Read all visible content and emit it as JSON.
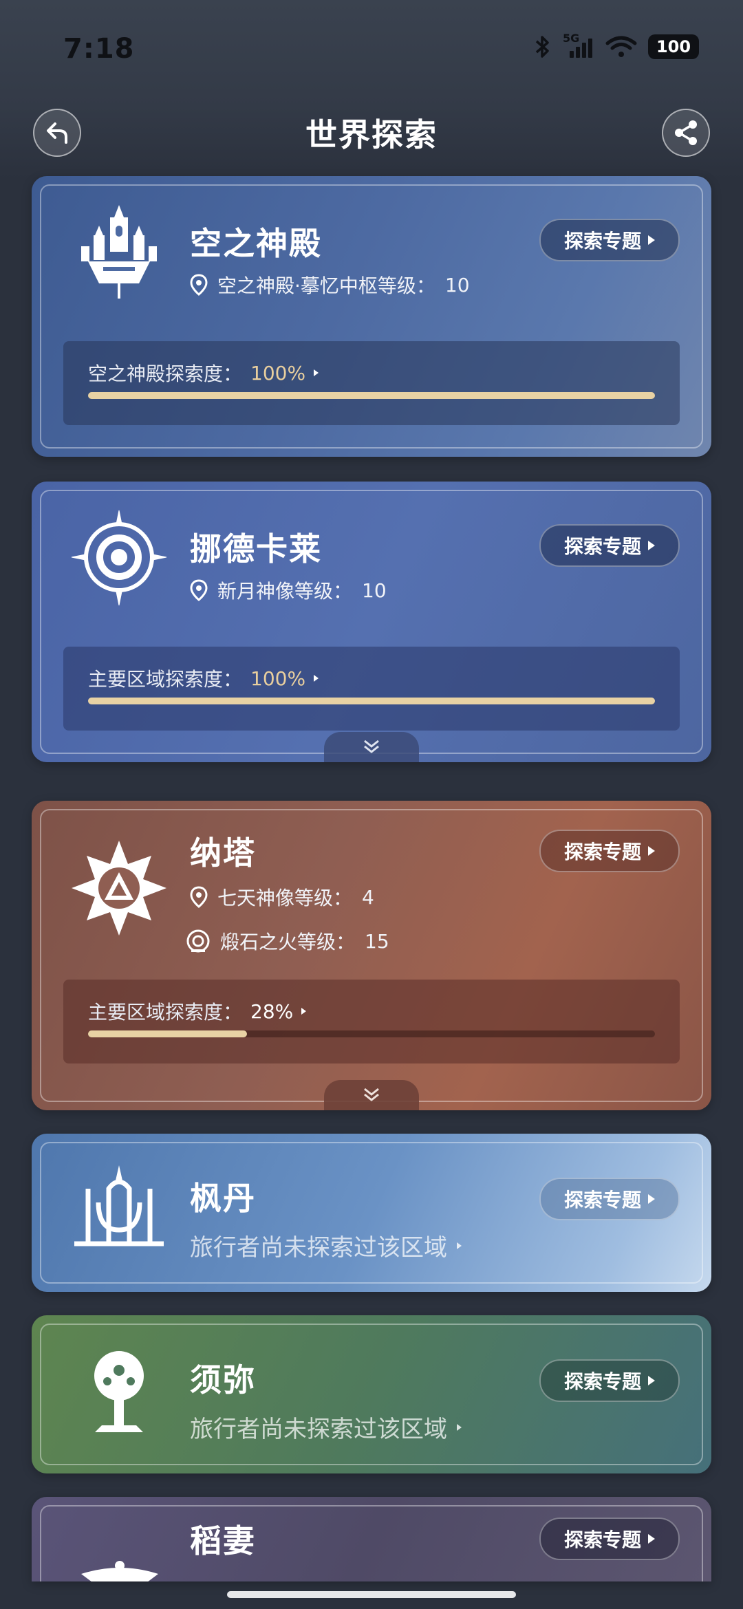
{
  "status_bar": {
    "time": "7:18",
    "network": "5G",
    "battery": "100"
  },
  "header": {
    "title": "世界探索",
    "back_icon": "back-arrow-icon",
    "share_icon": "share-icon"
  },
  "cards": [
    {
      "title": "空之神殿",
      "topic_label": "探索专题",
      "info": [
        {
          "icon": "location-pin-icon",
          "label": "空之神殿·摹忆中枢等级：",
          "value": "10"
        }
      ],
      "progress": {
        "label": "空之神殿探索度：",
        "value_text": "100%",
        "fraction": 1.0
      },
      "color": "#4a69a0"
    },
    {
      "title": "挪德卡莱",
      "topic_label": "探索专题",
      "info": [
        {
          "icon": "location-pin-icon",
          "label": "新月神像等级：",
          "value": "10"
        }
      ],
      "progress": {
        "label": "主要区域探索度：",
        "value_text": "100%",
        "fraction": 1.0
      },
      "color": "#4d67a8"
    },
    {
      "title": "纳塔",
      "topic_label": "探索专题",
      "info": [
        {
          "icon": "location-pin-icon",
          "label": "七天神像等级：",
          "value": "4"
        },
        {
          "icon": "fire-emblem-icon",
          "label": "煅石之火等级：",
          "value": "15"
        }
      ],
      "progress": {
        "label": "主要区域探索度：",
        "value_text": "28%",
        "fraction": 0.28
      },
      "color": "#8a5a50"
    },
    {
      "title": "枫丹",
      "topic_label": "探索专题",
      "status": "旅行者尚未探索过该区域",
      "color": "#5f85b8"
    },
    {
      "title": "须弥",
      "topic_label": "探索专题",
      "status": "旅行者尚未探索过该区域",
      "color": "#4e7a64"
    },
    {
      "title": "稻妻",
      "topic_label": "探索专题",
      "color": "#4f4a66"
    }
  ]
}
